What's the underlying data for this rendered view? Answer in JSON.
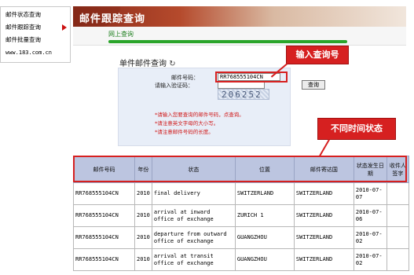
{
  "sidebar": {
    "items": [
      {
        "label": "邮件状态查询"
      },
      {
        "label": "邮件跟踪查询"
      },
      {
        "label": "邮件批量查询"
      }
    ],
    "url": "www.183.com.cn"
  },
  "header": {
    "title": "邮件跟踪查询",
    "tab": "网上查询"
  },
  "query": {
    "title": "单件邮件查询",
    "mail_no_label": "邮件号码：",
    "mail_no_value": "RR768555104CN",
    "code_label": "请输入验证码：",
    "code_value": "",
    "captcha_text": "206252",
    "button_label": "查询",
    "notes": [
      "*请输入您要查询的邮件号码，点查询。",
      "*请注意英文字母的大小写。",
      "*请注意邮件号码的长度。"
    ]
  },
  "callouts": {
    "input_hint": "输入查询号",
    "status_hint": "不同时间状态"
  },
  "table": {
    "headers": [
      "邮件号码",
      "年份",
      "状态",
      "位置",
      "邮件寄达国",
      "状态发生日期",
      "收件人签字"
    ],
    "rows": [
      {
        "no": "RR768555104CN",
        "year": "2010",
        "status": "final delivery",
        "location": "SWITZERLAND",
        "country": "SWITZERLAND",
        "date": "2010-07-07",
        "sign": ""
      },
      {
        "no": "RR768555104CN",
        "year": "2010",
        "status": "arrival at inward office of exchange",
        "location": "ZURICH 1",
        "country": "SWITZERLAND",
        "date": "2010-07-06",
        "sign": ""
      },
      {
        "no": "RR768555104CN",
        "year": "2010",
        "status": "departure from outward office of exchange",
        "location": "GUANGZHOU",
        "country": "SWITZERLAND",
        "date": "2010-07-02",
        "sign": ""
      },
      {
        "no": "RR768555104CN",
        "year": "2010",
        "status": "arrival at transit office of exchange",
        "location": "GUANGZHOU",
        "country": "SWITZERLAND",
        "date": "2010-07-02",
        "sign": ""
      }
    ]
  },
  "colors": {
    "accent_red": "#d62020",
    "banner_brown": "#8a2a1a",
    "table_header": "#bcc5e0",
    "green_rule": "#2aa52a"
  }
}
